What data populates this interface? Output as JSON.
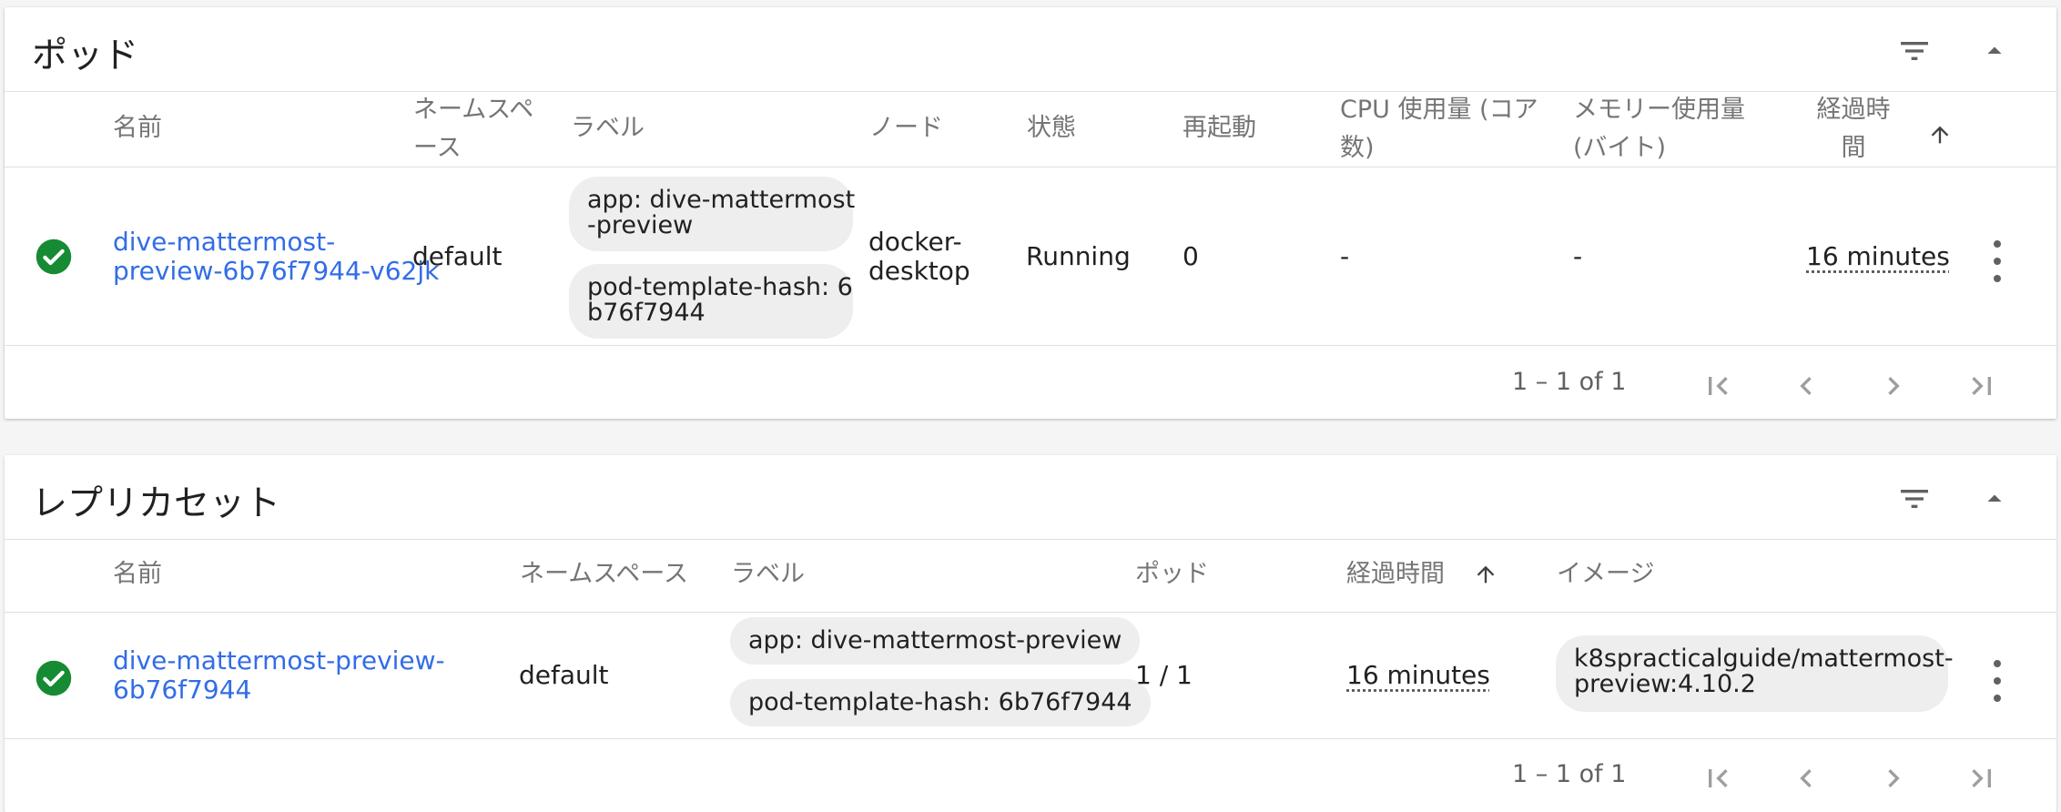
{
  "pods": {
    "title": "ポッド",
    "columns": {
      "name": "名前",
      "namespace_l1": "ネームスペ",
      "namespace_l2": "ース",
      "labels": "ラベル",
      "node": "ノード",
      "status": "状態",
      "restarts": "再起動",
      "cpu_l1": "CPU 使用量 (コア",
      "cpu_l2": "数)",
      "memory_l1": "メモリー使用量",
      "memory_l2": "(バイト)",
      "age_l1": "経過時",
      "age_l2": "間"
    },
    "row": {
      "status_icon": "check-circle-icon",
      "name_l1": "dive-mattermost-",
      "name_l2": "preview-6b76f7944-v62jk",
      "namespace": "default",
      "label_chips": [
        {
          "l1": "app: dive-mattermost",
          "l2": "-preview"
        },
        {
          "l1": "pod-template-hash: 6",
          "l2": "b76f7944"
        }
      ],
      "node_l1": "docker-",
      "node_l2": "desktop",
      "status": "Running",
      "restarts": "0",
      "cpu": "-",
      "memory": "-",
      "age": "16 minutes"
    },
    "pagination": {
      "range": "1 – 1 of 1"
    }
  },
  "replicasets": {
    "title": "レプリカセット",
    "columns": {
      "name": "名前",
      "namespace": "ネームスペース",
      "labels": "ラベル",
      "pods": "ポッド",
      "age": "経過時間",
      "images": "イメージ"
    },
    "row": {
      "status_icon": "check-circle-icon",
      "name_l1": "dive-mattermost-preview-",
      "name_l2": "6b76f7944",
      "namespace": "default",
      "label_chips": [
        "app: dive-mattermost-preview",
        "pod-template-hash: 6b76f7944"
      ],
      "pods": "1 / 1",
      "age": "16 minutes",
      "image_l1": "k8spracticalguide/mattermost-",
      "image_l2": "preview:4.10.2"
    },
    "pagination": {
      "range": "1 – 1 of 1"
    }
  },
  "colors": {
    "link": "#326de6",
    "success": "#168b34",
    "icon": "#616161",
    "chip_bg": "#eeeeee"
  }
}
